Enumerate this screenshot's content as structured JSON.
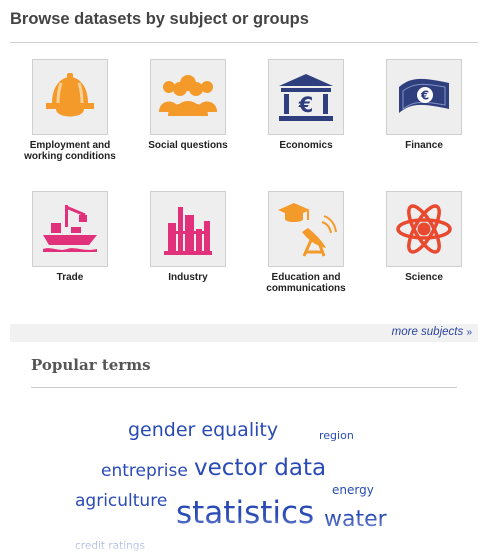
{
  "browse": {
    "title": "Browse datasets by subject or groups",
    "subjects": [
      {
        "label": "Employment and working conditions",
        "icon": "hard-hat-icon"
      },
      {
        "label": "Social questions",
        "icon": "people-group-icon"
      },
      {
        "label": "Economics",
        "icon": "euro-bank-icon"
      },
      {
        "label": "Finance",
        "icon": "euro-banknote-icon"
      },
      {
        "label": "Trade",
        "icon": "cargo-ship-icon"
      },
      {
        "label": "Industry",
        "icon": "factory-icon"
      },
      {
        "label": "Education and communications",
        "icon": "graduation-cap-satellite-icon"
      },
      {
        "label": "Science",
        "icon": "atom-icon"
      }
    ],
    "more_link": "more subjects",
    "more_icon": "double-chevron-down-icon"
  },
  "popular": {
    "title": "Popular terms",
    "terms": [
      "gender equality",
      "region",
      "entreprise",
      "vector data",
      "energy",
      "agriculture",
      "statistics",
      "water",
      "credit ratings"
    ]
  },
  "colors": {
    "icon_orange": "#f39a2a",
    "icon_navy": "#2f3f7d",
    "icon_pink": "#e0317a",
    "icon_red": "#e8492f",
    "term_blue": "#2a4bb5"
  }
}
